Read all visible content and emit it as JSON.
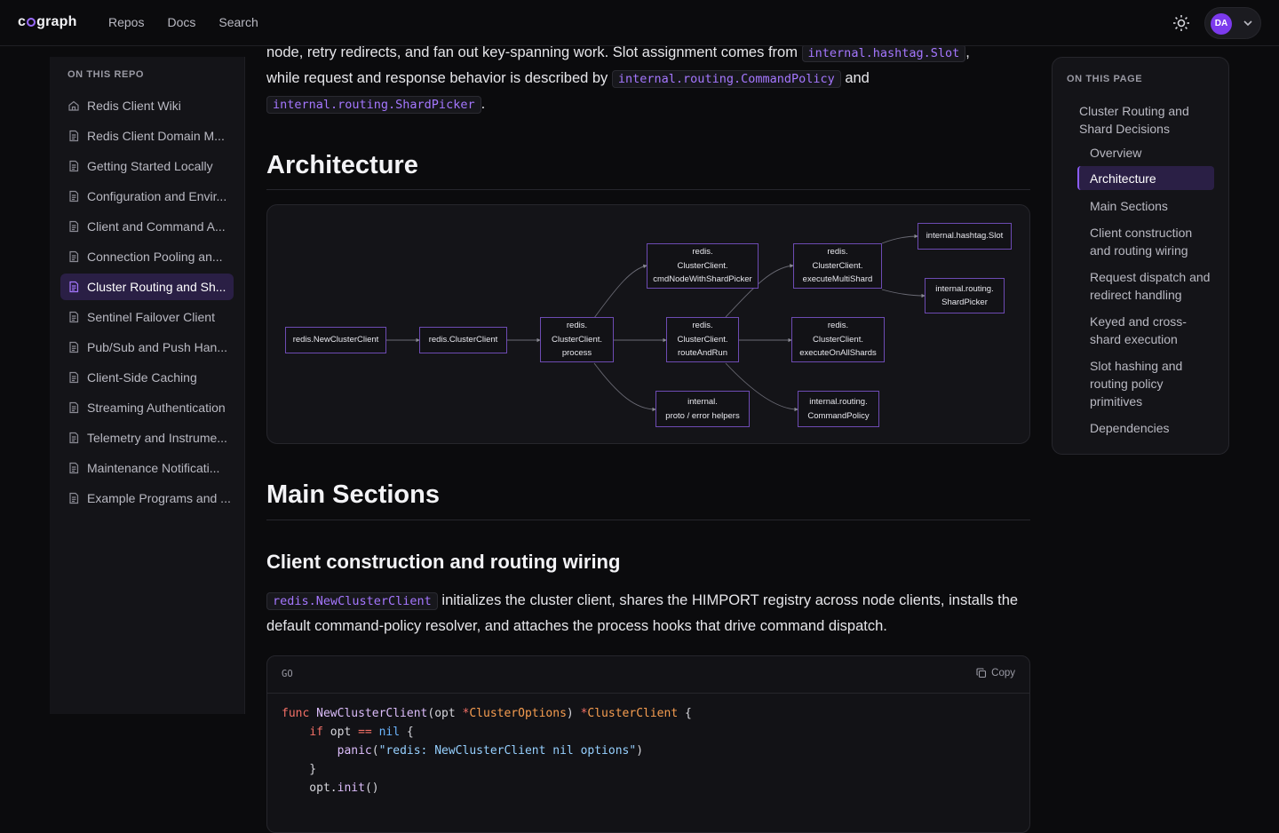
{
  "header": {
    "logo_text_a": "c",
    "logo_text_b": "graph",
    "nav": [
      "Repos",
      "Docs",
      "Search"
    ],
    "avatar_initials": "DA"
  },
  "sidebar": {
    "title": "ON THIS REPO",
    "items": [
      {
        "label": "Redis Client Wiki",
        "icon": "home-icon"
      },
      {
        "label": "Redis Client Domain M...",
        "icon": "doc-icon"
      },
      {
        "label": "Getting Started Locally",
        "icon": "doc-icon"
      },
      {
        "label": "Configuration and Envir...",
        "icon": "doc-icon"
      },
      {
        "label": "Client and Command A...",
        "icon": "doc-icon"
      },
      {
        "label": "Connection Pooling an...",
        "icon": "doc-icon"
      },
      {
        "label": "Cluster Routing and Sh...",
        "icon": "doc-icon",
        "active": true
      },
      {
        "label": "Sentinel Failover Client",
        "icon": "doc-icon"
      },
      {
        "label": "Pub/Sub and Push Han...",
        "icon": "doc-icon"
      },
      {
        "label": "Client-Side Caching",
        "icon": "doc-icon"
      },
      {
        "label": "Streaming Authentication",
        "icon": "doc-icon"
      },
      {
        "label": "Telemetry and Instrume...",
        "icon": "doc-icon"
      },
      {
        "label": "Maintenance Notificati...",
        "icon": "doc-icon"
      },
      {
        "label": "Example Programs and ...",
        "icon": "doc-icon"
      }
    ]
  },
  "main": {
    "intro_line1_text": "node, retry redirects, and fan out key-spanning work. Slot assignment comes from ",
    "intro_code1": "internal.hashtag.Slot",
    "intro_comma": ",",
    "intro_line2_text": "while request and response behavior is described by ",
    "intro_code2": "internal.routing.CommandPolicy",
    "intro_and": " and",
    "intro_code3": "internal.routing.ShardPicker",
    "intro_period": ".",
    "h_architecture": "Architecture",
    "h_main_sections": "Main Sections",
    "h_client_construction": "Client construction and routing wiring",
    "section_code": "redis.NewClusterClient",
    "section_text": " initializes the cluster client, shares the HIMPORT registry across node clients, installs the default command-policy resolver, and attaches the process hooks that drive command dispatch.",
    "code_lang": "GO",
    "copy_label": "Copy",
    "code_lines": [
      "func NewClusterClient(opt *ClusterOptions) *ClusterClient {",
      "    if opt == nil {",
      "        panic(\"redis: NewClusterClient nil options\")",
      "    }",
      "    opt.init()"
    ]
  },
  "diagram": {
    "nodes": {
      "new_cluster_client": [
        "redis.NewClusterClient"
      ],
      "cluster_client": [
        "redis.ClusterClient"
      ],
      "process": [
        "redis.",
        "ClusterClient.",
        "process"
      ],
      "cmd_node": [
        "redis.",
        "ClusterClient.",
        "cmdNodeWithShardPicker"
      ],
      "route_and_run": [
        "redis.",
        "ClusterClient.",
        "routeAndRun"
      ],
      "helpers": [
        "internal.",
        "proto / error helpers"
      ],
      "execute_multi": [
        "redis.",
        "ClusterClient.",
        "executeMultiShard"
      ],
      "execute_all": [
        "redis.",
        "ClusterClient.",
        "executeOnAllShards"
      ],
      "command_policy": [
        "internal.routing.",
        "CommandPolicy"
      ],
      "hashtag_slot": [
        "internal.hashtag.Slot"
      ],
      "shard_picker": [
        "internal.routing.",
        "ShardPicker"
      ]
    }
  },
  "toc": {
    "title": "ON THIS PAGE",
    "items": [
      {
        "label": "Cluster Routing and Shard Decisions"
      },
      {
        "label": "Overview"
      },
      {
        "label": "Architecture",
        "active": true
      },
      {
        "label": "Main Sections"
      },
      {
        "label": "Client construction and routing wiring"
      },
      {
        "label": "Request dispatch and redirect handling"
      },
      {
        "label": "Keyed and cross-shard execution"
      },
      {
        "label": "Slot hashing and routing policy primitives"
      },
      {
        "label": "Dependencies"
      }
    ]
  },
  "colors": {
    "accent": "#8b5cf6",
    "background": "#0b0b0d",
    "active_bg": "#2a1f45"
  }
}
